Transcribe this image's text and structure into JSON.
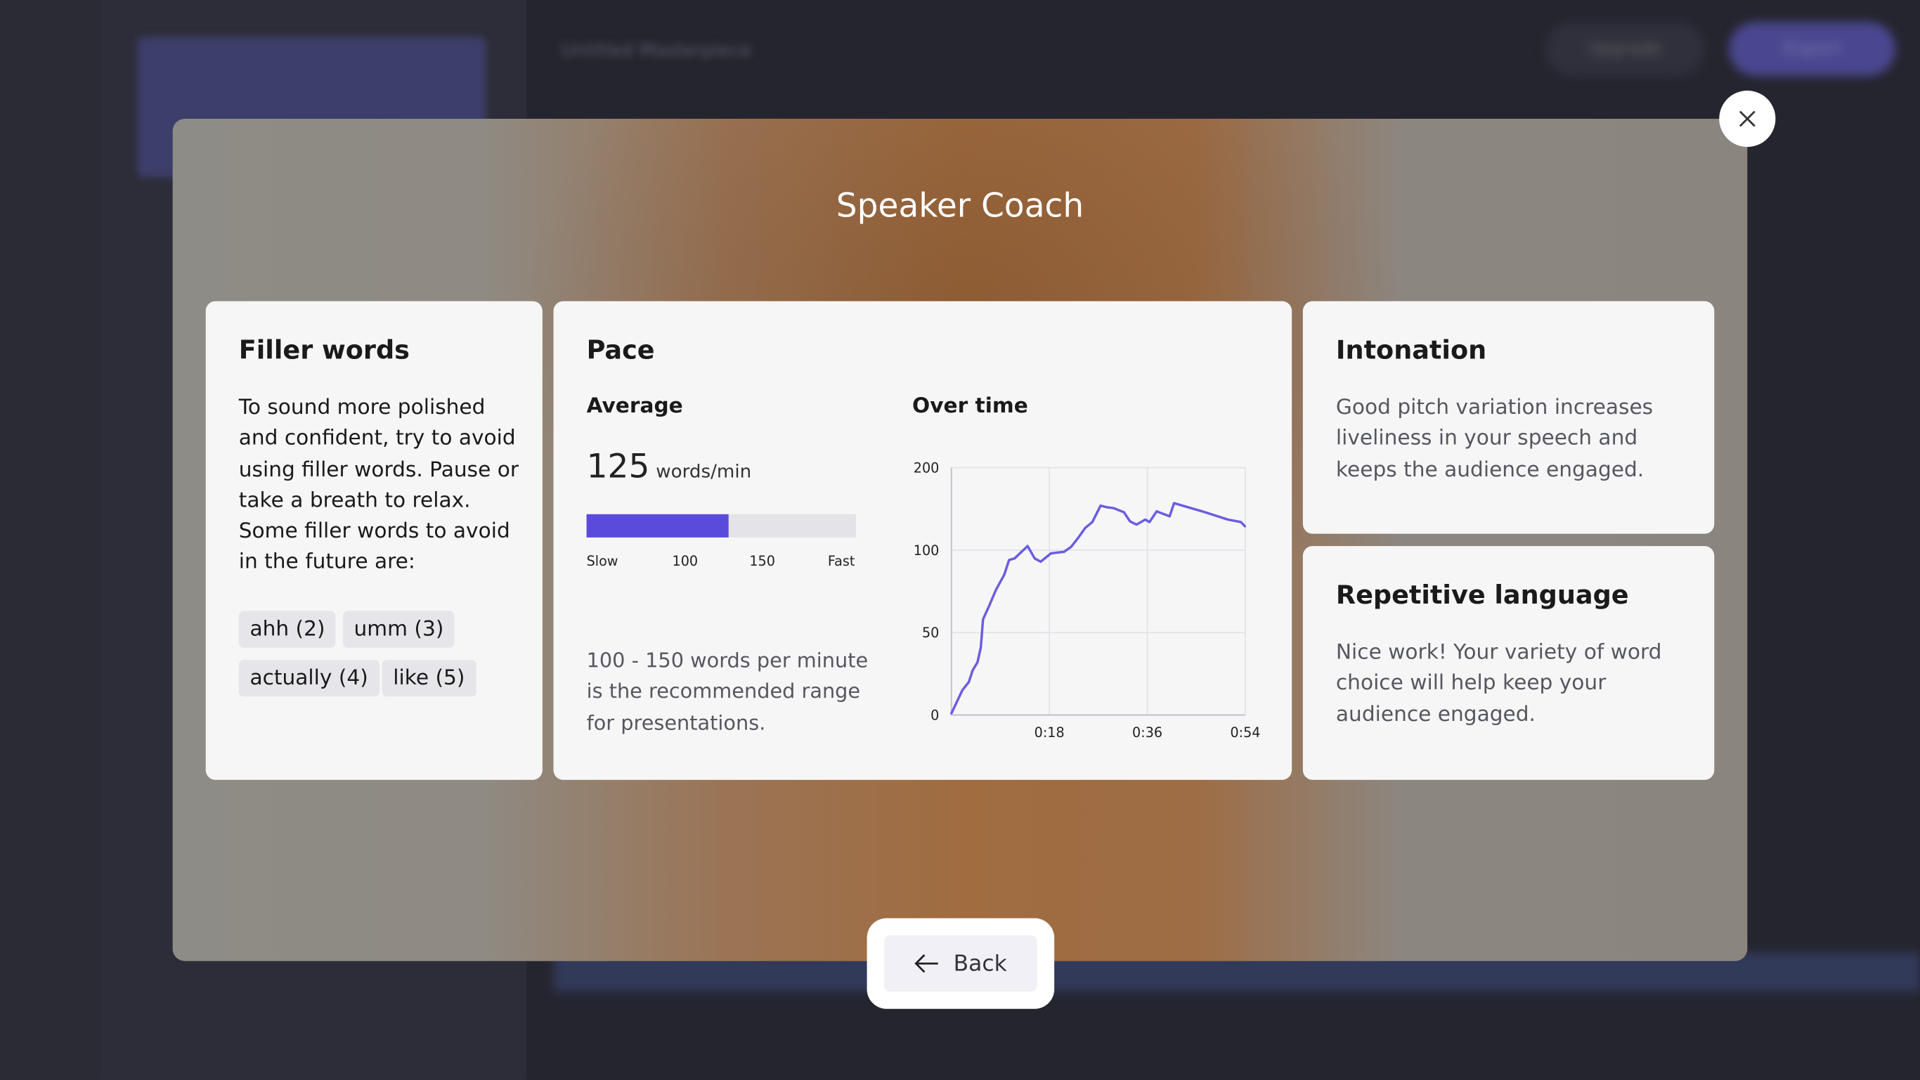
{
  "background": {
    "project_title": "Untitled Masterpiece",
    "upgrade_label": "Upgrade",
    "export_label": "Export"
  },
  "modal": {
    "title": "Speaker Coach",
    "close_icon": "close-icon",
    "back_label": "Back",
    "back_icon": "arrow-left-icon"
  },
  "filler": {
    "title": "Filler words",
    "lines": [
      "To sound more polished",
      "and confident, try to avoid",
      "using filler words. Pause or",
      "take a breath to relax.",
      "Some filler words to avoid",
      "in the future are:"
    ],
    "chips": [
      "ahh (2)",
      "umm (3)",
      "actually (4)",
      "like (5)"
    ]
  },
  "pace": {
    "title": "Pace",
    "average_label": "Average",
    "value": "125",
    "unit": "words/min",
    "bar_fraction": 0.527,
    "bar_color": "#5b4bdb",
    "bar_labels": [
      "Slow",
      "100",
      "150",
      "Fast"
    ],
    "note_lines": [
      "100 - 150 words per minute",
      "is the recommended range",
      "for presentations."
    ],
    "over_time_label": "Over time"
  },
  "intonation": {
    "title": "Intonation",
    "lines": [
      "Good pitch variation increases",
      "liveliness in your speech and",
      "keeps the audience engaged."
    ]
  },
  "repetitive": {
    "title": "Repetitive language",
    "lines": [
      "Nice work! Your variety of word",
      "choice will help keep your",
      "audience engaged."
    ]
  },
  "chart_data": {
    "type": "line",
    "title": "Over time",
    "xlabel": "",
    "ylabel": "",
    "x_ticks": [
      "0:18",
      "0:36",
      "0:54"
    ],
    "x_tick_values": [
      18,
      36,
      54
    ],
    "y_ticks": [
      "0",
      "50",
      "100",
      "200"
    ],
    "y_tick_values": [
      0,
      50,
      100,
      200
    ],
    "xlim": [
      0,
      54
    ],
    "grid": true,
    "line_color": "#6a5ee0",
    "series": [
      {
        "x": [
          0,
          2,
          3.2,
          3.9,
          4.8,
          5.4,
          5.8,
          6.9,
          8.2,
          9.7,
          10.6,
          11.6,
          14,
          15.3,
          16.4,
          18.3,
          20.7,
          22,
          23.3,
          24.6,
          25.9,
          27.4,
          28.5,
          29.8,
          31.7,
          32.8,
          34,
          35.6,
          36.4,
          37.7,
          40.1,
          40.9,
          46.1,
          50.8,
          53.2,
          53.9
        ],
        "y": [
          1,
          15,
          20,
          27,
          32,
          41,
          58,
          66,
          76,
          85,
          94,
          95,
          105,
          95,
          93,
          98,
          99,
          104,
          115,
          127,
          134,
          154,
          152,
          151,
          146,
          135,
          131,
          137,
          134,
          147,
          141,
          157,
          147,
          137,
          134,
          129
        ]
      }
    ]
  }
}
